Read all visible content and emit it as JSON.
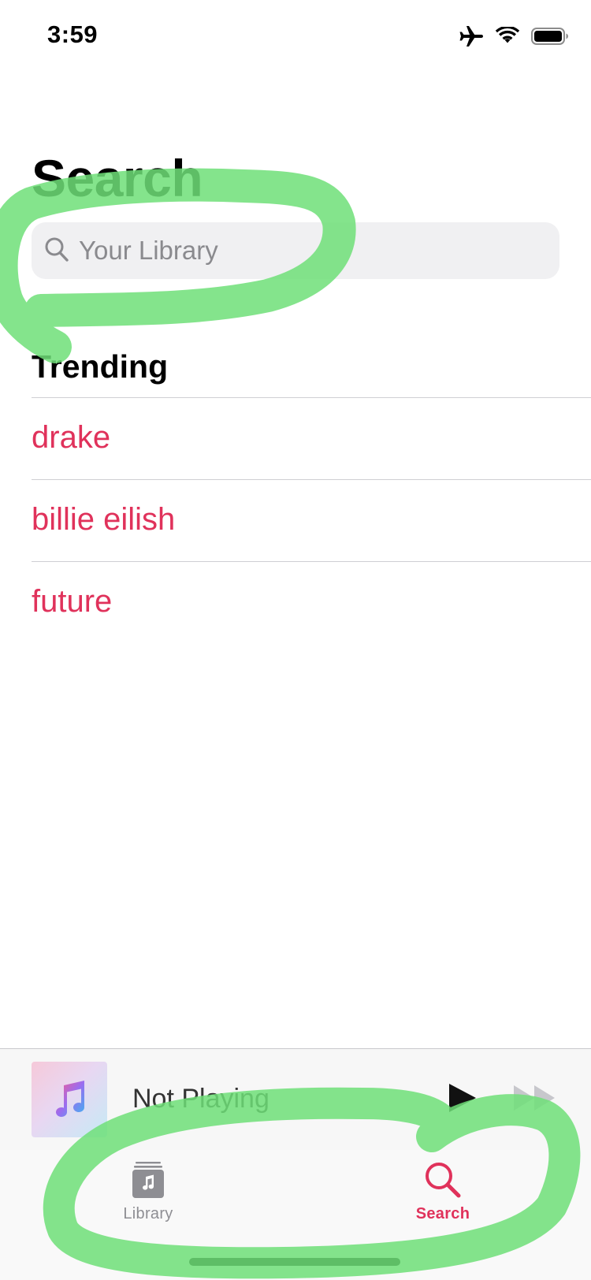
{
  "status_bar": {
    "time": "3:59",
    "icons": [
      "airplane-icon",
      "wifi-icon",
      "battery-icon"
    ]
  },
  "page": {
    "title": "Search"
  },
  "search": {
    "placeholder": "Your Library",
    "value": ""
  },
  "trending": {
    "header": "Trending",
    "items": [
      {
        "label": "drake"
      },
      {
        "label": "billie eilish"
      },
      {
        "label": "future"
      }
    ]
  },
  "mini_player": {
    "status": "Not Playing",
    "artwork_icon": "music-note-icon"
  },
  "tab_bar": {
    "tabs": [
      {
        "label": "Library",
        "icon": "library-icon",
        "selected": false
      },
      {
        "label": "Search",
        "icon": "search-icon",
        "selected": true
      }
    ]
  },
  "colors": {
    "accent": "#e0325b",
    "annotation": "#6fdf78",
    "search_field_bg": "#f0f0f2"
  }
}
